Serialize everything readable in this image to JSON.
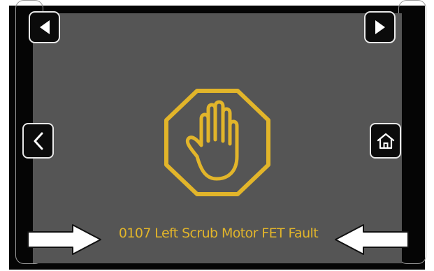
{
  "screen": {
    "fault_message": "0107 Left Scrub Motor FET Fault"
  },
  "icons": {
    "prev": "triangle-left-icon",
    "next": "triangle-right-icon",
    "back": "chevron-left-icon",
    "home": "home-icon",
    "fault": "stop-hand-icon",
    "callouts": "callout-arrow-icon"
  },
  "colors": {
    "warning": "#e2b52a",
    "screen_background": "#555555",
    "bezel": "#050505",
    "button_border": "#e8e8e8"
  }
}
